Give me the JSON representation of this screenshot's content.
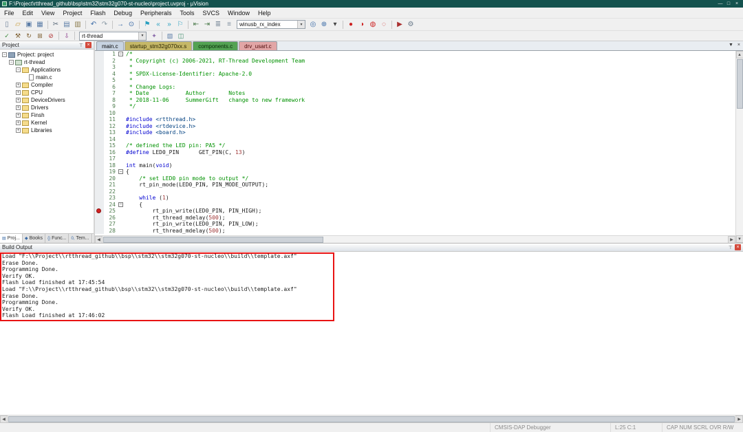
{
  "window": {
    "title": "F:\\Project\\rtthread_github\\bsp\\stm32\\stm32g070-st-nucleo\\project.uvproj - µVision"
  },
  "icons": {
    "pin": "⊤",
    "close": "×",
    "minimize": "—",
    "maximize": "□",
    "tab_menu": "▼",
    "scroll_up": "▲",
    "scroll_down": "▼",
    "scroll_left": "◀",
    "scroll_right": "▶"
  },
  "menubar": [
    "File",
    "Edit",
    "View",
    "Project",
    "Flash",
    "Debug",
    "Peripherals",
    "Tools",
    "SVCS",
    "Window",
    "Help"
  ],
  "toolbar_main": {
    "items": [
      {
        "t": "i",
        "n": "new-file",
        "g": "▯",
        "c": "#6b7f96"
      },
      {
        "t": "i",
        "n": "open-file",
        "g": "▱",
        "c": "#c79b3b"
      },
      {
        "t": "i",
        "n": "save",
        "g": "▣",
        "c": "#5a7ca6"
      },
      {
        "t": "i",
        "n": "save-all",
        "g": "▦",
        "c": "#5a7ca6"
      },
      {
        "t": "s"
      },
      {
        "t": "i",
        "n": "cut",
        "g": "✂",
        "c": "#5a6a7a"
      },
      {
        "t": "i",
        "n": "copy",
        "g": "▤",
        "c": "#5a7ca6"
      },
      {
        "t": "i",
        "n": "paste",
        "g": "▥",
        "c": "#8a7a4a"
      },
      {
        "t": "s"
      },
      {
        "t": "i",
        "n": "undo",
        "g": "↶",
        "c": "#3a6aa6"
      },
      {
        "t": "i",
        "n": "redo",
        "g": "↷",
        "c": "#8a9aa6"
      },
      {
        "t": "s"
      },
      {
        "t": "i",
        "n": "goto-line",
        "g": "→",
        "c": "#3a6aa6"
      },
      {
        "t": "i",
        "n": "find",
        "g": "⊙",
        "c": "#3a6aa6"
      },
      {
        "t": "s"
      },
      {
        "t": "i",
        "n": "bookmark-toggle",
        "g": "⚑",
        "c": "#2aa0c0"
      },
      {
        "t": "i",
        "n": "bookmark-prev",
        "g": "«",
        "c": "#2aa0c0"
      },
      {
        "t": "i",
        "n": "bookmark-next",
        "g": "»",
        "c": "#2aa0c0"
      },
      {
        "t": "i",
        "n": "bookmark-clear-all",
        "g": "⚐",
        "c": "#2aa0c0"
      },
      {
        "t": "s"
      },
      {
        "t": "i",
        "n": "indent-left",
        "g": "⇤",
        "c": "#4a7a4a"
      },
      {
        "t": "i",
        "n": "indent-right",
        "g": "⇥",
        "c": "#4a7a4a"
      },
      {
        "t": "i",
        "n": "comment-selection",
        "g": "≣",
        "c": "#7a8a9a"
      },
      {
        "t": "i",
        "n": "uncomment-selection",
        "g": "≡",
        "c": "#7a8a9a"
      },
      {
        "t": "c",
        "n": "find-text-combo",
        "v": "winusb_rx_index",
        "w": 100
      },
      {
        "t": "i",
        "n": "find-in-files",
        "g": "◎",
        "c": "#3a6aa6"
      },
      {
        "t": "i",
        "n": "zoom",
        "g": "⊕",
        "c": "#3a6aa6"
      },
      {
        "t": "i",
        "n": "zoom-menu-arrow",
        "g": "▾",
        "c": "#444444"
      },
      {
        "t": "s"
      },
      {
        "t": "i",
        "n": "insert-breakpoint",
        "g": "●",
        "c": "#cc2020"
      },
      {
        "t": "i",
        "n": "enable-disable-breakpoint",
        "g": "◑",
        "c": "#cc2020"
      },
      {
        "t": "i",
        "n": "disable-all-breakpoints",
        "g": "◍",
        "c": "#cc2020"
      },
      {
        "t": "i",
        "n": "kill-all-breakpoints",
        "g": "◌",
        "c": "#cc2020"
      },
      {
        "t": "s"
      },
      {
        "t": "i",
        "n": "start-stop-debug",
        "g": "▶",
        "c": "#aa3030"
      },
      {
        "t": "i",
        "n": "configure-flash-tools",
        "g": "⚙",
        "c": "#6a7a8a"
      }
    ]
  },
  "toolbar_build": {
    "items": [
      {
        "t": "i",
        "n": "translate-file",
        "g": "✓",
        "c": "#3a8a3a"
      },
      {
        "t": "i",
        "n": "build",
        "g": "⚒",
        "c": "#7a5a2a"
      },
      {
        "t": "i",
        "n": "rebuild-all",
        "g": "↻",
        "c": "#7a5a2a"
      },
      {
        "t": "i",
        "n": "batch-build",
        "g": "⊞",
        "c": "#7a5a2a"
      },
      {
        "t": "i",
        "n": "stop-build",
        "g": "⊘",
        "c": "#b03030"
      },
      {
        "t": "s"
      },
      {
        "t": "i",
        "n": "flash-download",
        "g": "⇩",
        "c": "#8a3a8a"
      },
      {
        "t": "s"
      },
      {
        "t": "c",
        "n": "target-select-combo",
        "v": "rt-thread",
        "w": 98
      },
      {
        "t": "i",
        "n": "options-for-target",
        "g": "✦",
        "c": "#8a6aaa"
      },
      {
        "t": "s"
      },
      {
        "t": "i",
        "n": "file-extensions",
        "g": "▧",
        "c": "#5a7ca6"
      },
      {
        "t": "i",
        "n": "manage-rte",
        "g": "◫",
        "c": "#3a8a6a"
      }
    ]
  },
  "project_panel": {
    "title": "Project",
    "tree": [
      {
        "label": "Project: project",
        "level": 0,
        "icon": "target",
        "exp": "-"
      },
      {
        "label": "rt-thread",
        "level": 1,
        "icon": "chip",
        "exp": "-"
      },
      {
        "label": "Applications",
        "level": 2,
        "icon": "folder",
        "exp": "-"
      },
      {
        "label": "main.c",
        "level": 3,
        "icon": "file",
        "exp": ""
      },
      {
        "label": "Compiler",
        "level": 2,
        "icon": "folder",
        "exp": "+"
      },
      {
        "label": "CPU",
        "level": 2,
        "icon": "folder",
        "exp": "+"
      },
      {
        "label": "DeviceDrivers",
        "level": 2,
        "icon": "folder",
        "exp": "+"
      },
      {
        "label": "Drivers",
        "level": 2,
        "icon": "folder",
        "exp": "+"
      },
      {
        "label": "Finsh",
        "level": 2,
        "icon": "folder",
        "exp": "+"
      },
      {
        "label": "Kernel",
        "level": 2,
        "icon": "folder",
        "exp": "+"
      },
      {
        "label": "Libraries",
        "level": 2,
        "icon": "folder",
        "exp": "+"
      }
    ],
    "bottom_tabs": [
      {
        "icon": "▤",
        "icon_name": "project-tab-icon",
        "label": "Proj..."
      },
      {
        "icon": "◆",
        "icon_name": "books-tab-icon",
        "label": "Books"
      },
      {
        "icon": "{}",
        "icon_name": "functions-tab-icon",
        "label": "Func..."
      },
      {
        "icon": "0,",
        "icon_name": "templates-tab-icon",
        "label": "Tem..."
      }
    ]
  },
  "editor": {
    "tabs": [
      {
        "label": "main.c",
        "active": true,
        "bg": "#c8d4e2",
        "fg": "#000000"
      },
      {
        "label": "startup_stm32g070xx.s",
        "bg": "#c6b867",
        "fg": "#2a2400"
      },
      {
        "label": "components.c",
        "bg": "#53a253",
        "fg": "#062906"
      },
      {
        "label": "drv_usart.c",
        "bg": "#e2a6a6",
        "fg": "#4d0a0a"
      }
    ],
    "breakpoint_line": 25,
    "lines": [
      {
        "fold": "-",
        "segs": [
          [
            "c",
            "/*"
          ]
        ]
      },
      {
        "segs": [
          [
            "c",
            " * Copyright (c) 2006-2021, RT-Thread Development Team"
          ]
        ]
      },
      {
        "segs": [
          [
            "c",
            " *"
          ]
        ]
      },
      {
        "segs": [
          [
            "c",
            " * SPDX-License-Identifier: Apache-2.0"
          ]
        ]
      },
      {
        "segs": [
          [
            "c",
            " *"
          ]
        ]
      },
      {
        "segs": [
          [
            "c",
            " * Change Logs:"
          ]
        ]
      },
      {
        "segs": [
          [
            "c",
            " * Date           Author       Notes"
          ]
        ]
      },
      {
        "segs": [
          [
            "c",
            " * 2018-11-06     SummerGift   change to new framework"
          ]
        ]
      },
      {
        "segs": [
          [
            "c",
            " */"
          ]
        ]
      },
      {
        "segs": []
      },
      {
        "segs": [
          [
            "k",
            "#include "
          ],
          [
            "s",
            "<rtthread.h>"
          ]
        ]
      },
      {
        "segs": [
          [
            "k",
            "#include "
          ],
          [
            "s",
            "<rtdevice.h>"
          ]
        ]
      },
      {
        "segs": [
          [
            "k",
            "#include "
          ],
          [
            "s",
            "<board.h>"
          ]
        ]
      },
      {
        "segs": []
      },
      {
        "segs": [
          [
            "c",
            "/* defined the LED pin: PA5 */"
          ]
        ]
      },
      {
        "segs": [
          [
            "k",
            "#define "
          ],
          [
            "t",
            "LED0_PIN      GET_PIN(C, "
          ],
          [
            "n",
            "13"
          ],
          [
            "t",
            ")"
          ]
        ]
      },
      {
        "segs": []
      },
      {
        "segs": [
          [
            "k",
            "int"
          ],
          [
            "t",
            " main("
          ],
          [
            "k",
            "void"
          ],
          [
            "t",
            ")"
          ]
        ]
      },
      {
        "fold": "-",
        "segs": [
          [
            "t",
            "{"
          ]
        ]
      },
      {
        "segs": [
          [
            "c",
            "    /* set LED0 pin mode to output */"
          ]
        ]
      },
      {
        "segs": [
          [
            "t",
            "    rt_pin_mode(LED0_PIN, PIN_MODE_OUTPUT);"
          ]
        ]
      },
      {
        "segs": []
      },
      {
        "segs": [
          [
            "t",
            "    "
          ],
          [
            "k",
            "while"
          ],
          [
            "t",
            " ("
          ],
          [
            "n",
            "1"
          ],
          [
            "t",
            ")"
          ]
        ]
      },
      {
        "fold": "-",
        "segs": [
          [
            "t",
            "    {"
          ]
        ]
      },
      {
        "segs": [
          [
            "t",
            "        rt_pin_write(LED0_PIN, PIN_HIGH);"
          ]
        ]
      },
      {
        "segs": [
          [
            "t",
            "        rt_thread_mdelay("
          ],
          [
            "n",
            "500"
          ],
          [
            "t",
            ");"
          ]
        ]
      },
      {
        "segs": [
          [
            "t",
            "        rt_pin_write(LED0_PIN, PIN_LOW);"
          ]
        ]
      },
      {
        "segs": [
          [
            "t",
            "        rt_thread_mdelay("
          ],
          [
            "n",
            "500"
          ],
          [
            "t",
            ");"
          ]
        ]
      }
    ]
  },
  "build_output": {
    "title": "Build Output",
    "annotation_color": "#e81313",
    "lines": [
      "Load \"F:\\\\Project\\\\rtthread_github\\\\bsp\\\\stm32\\\\stm32g070-st-nucleo\\\\build\\\\template.axf\"",
      "Erase Done.",
      "Programming Done.",
      "Verify OK.",
      "Flash Load finished at 17:45:54",
      "Load \"F:\\\\Project\\\\rtthread_github\\\\bsp\\\\stm32\\\\stm32g070-st-nucleo\\\\build\\\\template.axf\"",
      "Erase Done.",
      "Programming Done.",
      "Verify OK.",
      "Flash Load finished at 17:46:02"
    ]
  },
  "statusbar": {
    "debugger": "CMSIS-DAP Debugger",
    "cursor": "L:25 C:1",
    "flags": "CAP NUM SCRL OVR R/W"
  }
}
